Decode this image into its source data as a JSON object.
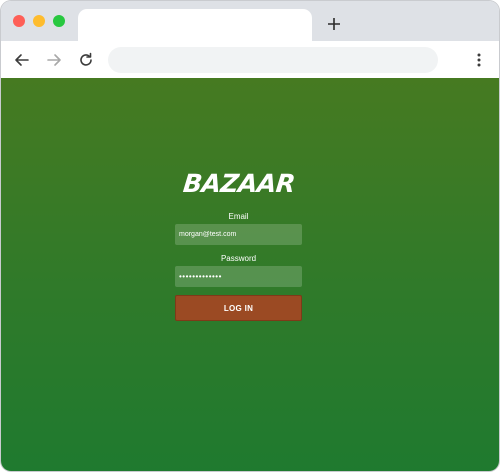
{
  "browser": {
    "tab_title": "",
    "new_tab_icon": "plus-icon",
    "back_icon": "arrow-left-icon",
    "forward_icon": "arrow-right-icon",
    "reload_icon": "reload-icon",
    "menu_icon": "kebab-menu-icon",
    "address_value": "",
    "traffic_lights": {
      "close": "#fe5f57",
      "minimize": "#febc2e",
      "maximize": "#28c840"
    }
  },
  "login": {
    "brand": "BAZAAR",
    "email_label": "Email",
    "email_value": "morgan@test.com",
    "password_label": "Password",
    "password_value": "•••••••••••••",
    "submit_label": "LOG IN"
  },
  "colors": {
    "background_top": "#467a21",
    "background_bottom": "#1f7a2f",
    "button": "#9b4a23"
  }
}
